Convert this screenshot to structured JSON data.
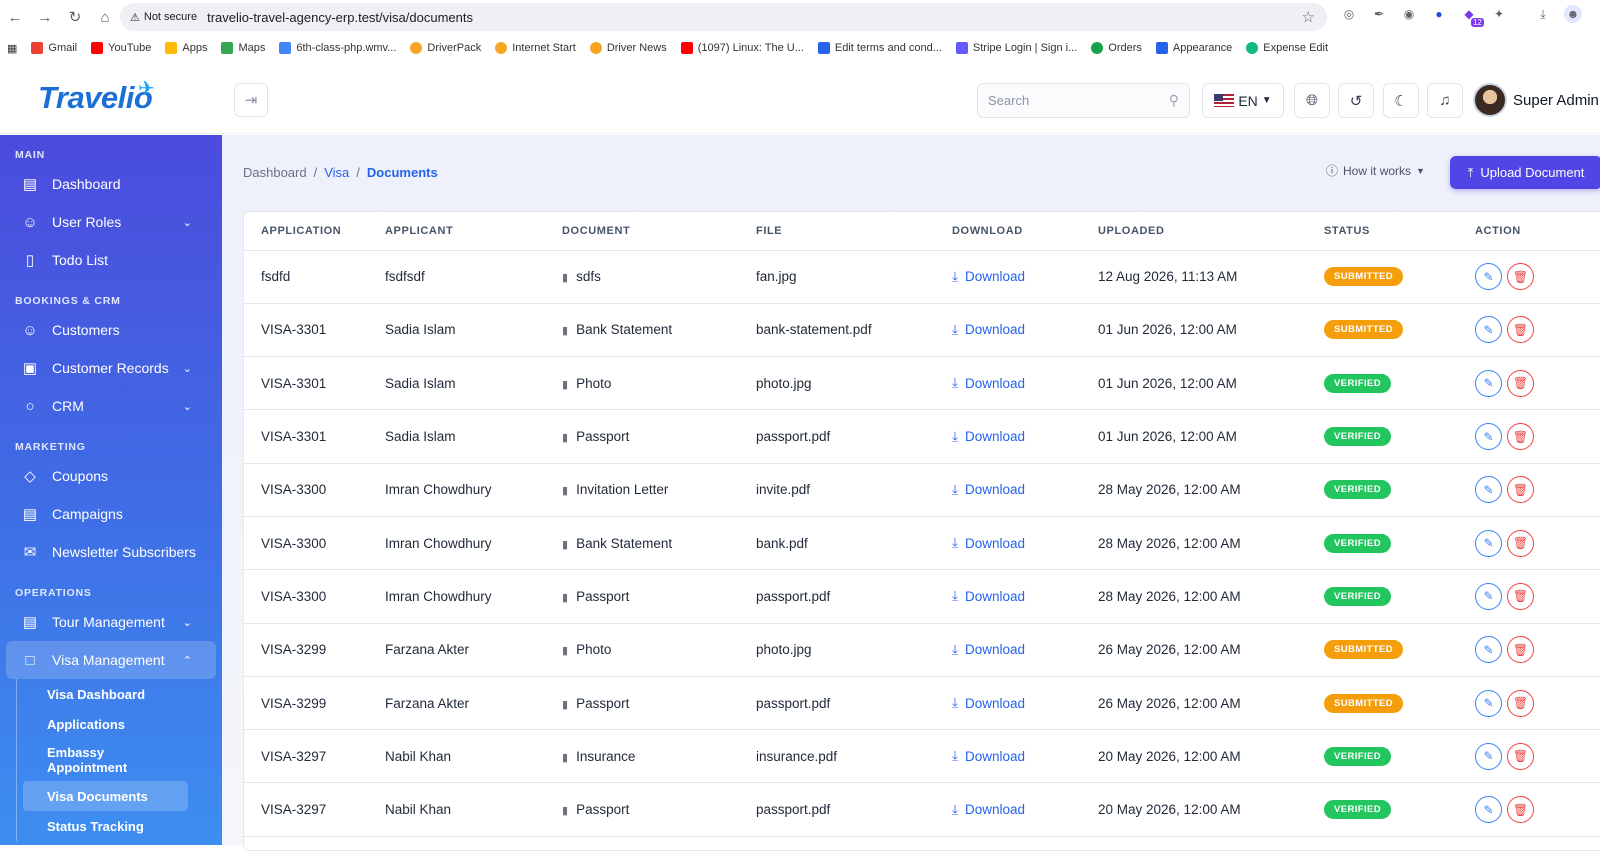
{
  "browser": {
    "security_label": "Not secure",
    "url": "travelio-travel-agency-erp.test/visa/documents",
    "bookmarks": [
      "Gmail",
      "YouTube",
      "Apps",
      "Maps",
      "6th-class-php.wmv...",
      "DriverPack",
      "Internet Start",
      "Driver News",
      "(1097) Linux: The U...",
      "Edit terms and cond...",
      "Stripe Login | Sign i...",
      "Orders",
      "Appearance",
      "Expense Edit"
    ],
    "extension_badge": "12"
  },
  "header": {
    "logo": "Travelio",
    "search_placeholder": "Search",
    "language": "EN",
    "user_name": "Super Admin"
  },
  "sidebar": {
    "sections": [
      {
        "title": "MAIN",
        "items": [
          {
            "label": "Dashboard",
            "icon": "chart-icon"
          },
          {
            "label": "User Roles",
            "icon": "users-icon",
            "chevron": true
          },
          {
            "label": "Todo List",
            "icon": "clipboard-icon"
          }
        ]
      },
      {
        "title": "BOOKINGS & CRM",
        "items": [
          {
            "label": "Customers",
            "icon": "user-icon"
          },
          {
            "label": "Customer Records",
            "icon": "records-icon",
            "chevron": true
          },
          {
            "label": "CRM",
            "icon": "chat-icon",
            "chevron": true
          }
        ]
      },
      {
        "title": "MARKETING",
        "items": [
          {
            "label": "Coupons",
            "icon": "tag-icon"
          },
          {
            "label": "Campaigns",
            "icon": "message-icon"
          },
          {
            "label": "Newsletter Subscribers",
            "icon": "mail-icon"
          }
        ]
      },
      {
        "title": "OPERATIONS",
        "items": [
          {
            "label": "Tour Management",
            "icon": "map-icon",
            "chevron": true
          },
          {
            "label": "Visa Management",
            "icon": "document-icon",
            "chevron": true,
            "active": true
          }
        ]
      }
    ],
    "visa_sub": [
      "Visa Dashboard",
      "Applications",
      "Embassy Appointment",
      "Visa Documents",
      "Status Tracking"
    ]
  },
  "page": {
    "breadcrumb": [
      "Dashboard",
      "Visa",
      "Documents"
    ],
    "how_it_works": "How it works",
    "upload_button": "Upload Document"
  },
  "table": {
    "columns": [
      "APPLICATION",
      "APPLICANT",
      "DOCUMENT",
      "FILE",
      "DOWNLOAD",
      "UPLOADED",
      "STATUS",
      "ACTION"
    ],
    "download_label": "Download",
    "rows": [
      {
        "application": "fsdfd",
        "applicant": "fsdfsdf",
        "document": "sdfs",
        "file": "fan.jpg",
        "uploaded": "12 Aug 2026, 11:13 AM",
        "status": "SUBMITTED"
      },
      {
        "application": "VISA-3301",
        "applicant": "Sadia Islam",
        "document": "Bank Statement",
        "file": "bank-statement.pdf",
        "uploaded": "01 Jun 2026, 12:00 AM",
        "status": "SUBMITTED"
      },
      {
        "application": "VISA-3301",
        "applicant": "Sadia Islam",
        "document": "Photo",
        "file": "photo.jpg",
        "uploaded": "01 Jun 2026, 12:00 AM",
        "status": "VERIFIED"
      },
      {
        "application": "VISA-3301",
        "applicant": "Sadia Islam",
        "document": "Passport",
        "file": "passport.pdf",
        "uploaded": "01 Jun 2026, 12:00 AM",
        "status": "VERIFIED"
      },
      {
        "application": "VISA-3300",
        "applicant": "Imran Chowdhury",
        "document": "Invitation Letter",
        "file": "invite.pdf",
        "uploaded": "28 May 2026, 12:00 AM",
        "status": "VERIFIED"
      },
      {
        "application": "VISA-3300",
        "applicant": "Imran Chowdhury",
        "document": "Bank Statement",
        "file": "bank.pdf",
        "uploaded": "28 May 2026, 12:00 AM",
        "status": "VERIFIED"
      },
      {
        "application": "VISA-3300",
        "applicant": "Imran Chowdhury",
        "document": "Passport",
        "file": "passport.pdf",
        "uploaded": "28 May 2026, 12:00 AM",
        "status": "VERIFIED"
      },
      {
        "application": "VISA-3299",
        "applicant": "Farzana Akter",
        "document": "Photo",
        "file": "photo.jpg",
        "uploaded": "26 May 2026, 12:00 AM",
        "status": "SUBMITTED"
      },
      {
        "application": "VISA-3299",
        "applicant": "Farzana Akter",
        "document": "Passport",
        "file": "passport.pdf",
        "uploaded": "26 May 2026, 12:00 AM",
        "status": "SUBMITTED"
      },
      {
        "application": "VISA-3297",
        "applicant": "Nabil Khan",
        "document": "Insurance",
        "file": "insurance.pdf",
        "uploaded": "20 May 2026, 12:00 AM",
        "status": "VERIFIED"
      },
      {
        "application": "VISA-3297",
        "applicant": "Nabil Khan",
        "document": "Passport",
        "file": "passport.pdf",
        "uploaded": "20 May 2026, 12:00 AM",
        "status": "VERIFIED"
      }
    ]
  },
  "colors": {
    "primary": "#4f46e5",
    "submitted": "#f59e0b",
    "verified": "#22c55e",
    "link": "#2563eb"
  }
}
